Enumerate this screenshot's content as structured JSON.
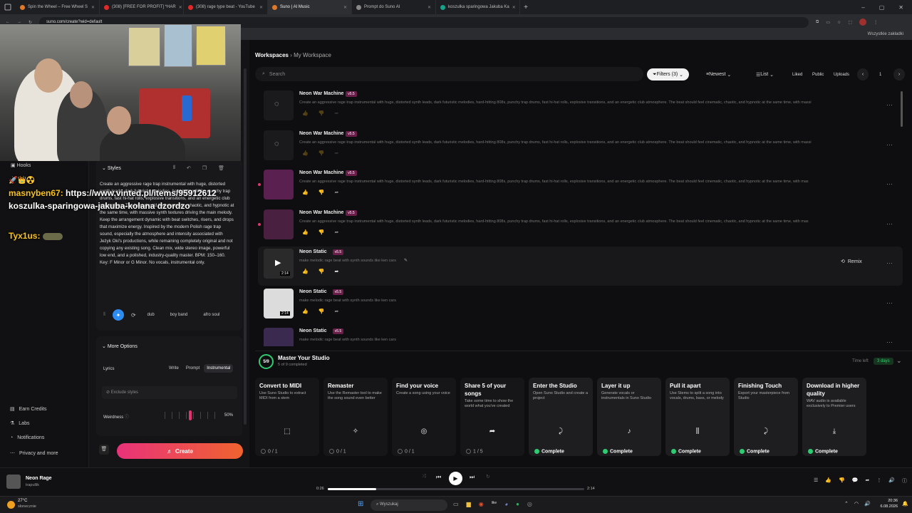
{
  "tabs": [
    {
      "label": "Spin the Wheel – Free Wheel S",
      "color": "#e07a2a"
    },
    {
      "label": "(308) [FREE FOR PROFIT] *HAR",
      "color": "#e02a2a"
    },
    {
      "label": "(308) rage type beat - YouTube",
      "color": "#e02a2a"
    },
    {
      "label": "Suno | AI Music",
      "color": "#e07a2a"
    },
    {
      "label": "Prompt do Suno AI",
      "color": "#888888"
    },
    {
      "label": "koszulka sparingowa Jakuba Ka",
      "color": "#17a38a"
    }
  ],
  "address": {
    "url": "suno.com/create?wid=default"
  },
  "bookmarks": {
    "all": "Wszystkie zakładki"
  },
  "sidebar": {
    "earn": "Earn Credits",
    "labs": "Labs",
    "notifications": "Notifications",
    "privacy": "Privacy and more"
  },
  "left": {
    "hooks": "Hooks",
    "styles_title": "Styles",
    "styles_text": "Create an aggressive rage trap instrumental with huge, distorted synth leads, dark futuristic melodies, hard-hitting 808s, punchy trap drums, fast hi-hat rolls, explosive transitions, and an energetic club atmosphere. The beat should feel cinematic, chaotic, and hypnotic at the same time, with massive synth textures driving the main melody. Keep the arrangement dynamic with beat switches, risers, and drops that maximize energy. Inspired by the modern Polish rage trap sound, especially the atmosphere and intensity associated with Jeżyk Oki's productions, while remaining completely original and not copying any existing song. Clean mix, wide stereo image, powerful low end, and a polished, industry-quality master. BPM: 150–160. Key: F Minor or G Minor. No vocals, instrumental only.",
    "chips": [
      "dub",
      "boy band",
      "afro soul"
    ],
    "more_options": "More Options",
    "lyrics": "Lyrics",
    "lyrics_modes": [
      "Write",
      "Prompt",
      "Instrumental"
    ],
    "exclude": "Exclude styles",
    "weirdness": "Weirdness",
    "weirdness_value": "50%",
    "create": "Create"
  },
  "chat": {
    "emojis": "🚀👑☢️",
    "user1": "masnyben67:",
    "msg1a": "https://www.vinted.pl/items/95912612",
    "msg1b": "koszulka-sparingowa-jakuba-kolana dzordzo",
    "user2": "Tyx1us:"
  },
  "main": {
    "crumb_root": "Workspaces",
    "crumb_current": "My Workspace",
    "search_placeholder": "Search",
    "filters": "Filters (3)",
    "sort": "Newest",
    "view": "List",
    "liked": "Liked",
    "public": "Public",
    "uploads": "Uploads",
    "page": "1"
  },
  "songs": [
    {
      "title": "Neon War Machine",
      "ver": "v5.5",
      "desc": "Create an aggressive rage trap instrumental with huge, distorted synth leads, dark futuristic melodies, hard-hitting 808s, punchy trap drums, fast hi-hat rolls, explosive transitions, and an energetic club atmosphere. The beat should feel cinematic, chaotic, and hypnotic at the same time, with massi"
    },
    {
      "title": "Neon War Machine",
      "ver": "v5.5",
      "desc": "Create an aggressive rage trap instrumental with huge, distorted synth leads, dark futuristic melodies, hard-hitting 808s, punchy trap drums, fast hi-hat rolls, explosive transitions, and an energetic club atmosphere. The beat should feel cinematic, chaotic, and hypnotic at the same time, with massi"
    },
    {
      "title": "Neon War Machine",
      "ver": "v5.5",
      "desc": "Create an aggressive rage trap instrumental with huge, distorted synth leads, dark futuristic melodies, hard-hitting 808s, punchy trap drums, fast hi-hat rolls, explosive transitions, and an energetic club atmosphere. The beat should feel cinematic, chaotic, and hypnotic at the same time, with mas"
    },
    {
      "title": "Neon War Machine",
      "ver": "v5.5",
      "desc": "Create an aggressive rage trap instrumental with huge, distorted synth leads, dark futuristic melodies, hard-hitting 808s, punchy trap drums, fast hi-hat rolls, explosive transitions, and an energetic club atmosphere. The beat should feel cinematic, chaotic, and hypnotic at the same time, with mas"
    },
    {
      "title": "Neon Static",
      "ver": "v5.5",
      "desc": "make melodic rage beat with synth sounds like ken cars",
      "duration": "2:14"
    },
    {
      "title": "Neon Static",
      "ver": "v5.5",
      "desc": "make melodic rage beat with synth sounds like ken cars",
      "duration": "2:14"
    },
    {
      "title": "Neon Static",
      "ver": "v5.5",
      "desc": "make melodic rage beat with synth sounds like ken cars"
    }
  ],
  "remix": "Remix",
  "studio": {
    "progress": "5/9",
    "title": "Master Your Studio",
    "subtitle": "5 of 9 completed",
    "time_left": "Time left",
    "days": "3 days",
    "cards": [
      {
        "title": "Convert to MIDI",
        "desc": "Use Suno Studio to extract MIDI from a stem",
        "status": "0 / 1",
        "done": false
      },
      {
        "title": "Remaster",
        "desc": "Use the Remaster tool to make the song sound even better",
        "status": "0 / 1",
        "done": false
      },
      {
        "title": "Find your voice",
        "desc": "Create a song using your voice",
        "status": "0 / 1",
        "done": false
      },
      {
        "title": "Share 5 of your songs",
        "desc": "Take some time to show the world what you've created",
        "status": "1 / 5",
        "done": false
      },
      {
        "title": "Enter the Studio",
        "desc": "Open Suno Studio and create a project",
        "status": "Complete",
        "done": true
      },
      {
        "title": "Layer it up",
        "desc": "Generate vocals or instrumentals in Suno Studio",
        "status": "Complete",
        "done": true
      },
      {
        "title": "Pull it apart",
        "desc": "Use Stems to split a song into vocals, drums, bass, or melody",
        "status": "Complete",
        "done": true
      },
      {
        "title": "Finishing Touch",
        "desc": "Export your masterpiece from Studio",
        "status": "Complete",
        "done": true
      },
      {
        "title": "Download in higher quality",
        "desc": "WAV audio is available exclusively to Premier users",
        "status": "Complete",
        "done": true
      }
    ]
  },
  "player": {
    "title": "Neon Rage",
    "artist": "trapullik",
    "current": "0:26",
    "total": "2:14",
    "progress": 0.19
  },
  "taskbar": {
    "weather": "27°C",
    "weather_desc": "słonecznie",
    "search": "Wyszukaj",
    "time": "20:36",
    "date": "6.08.2026"
  }
}
